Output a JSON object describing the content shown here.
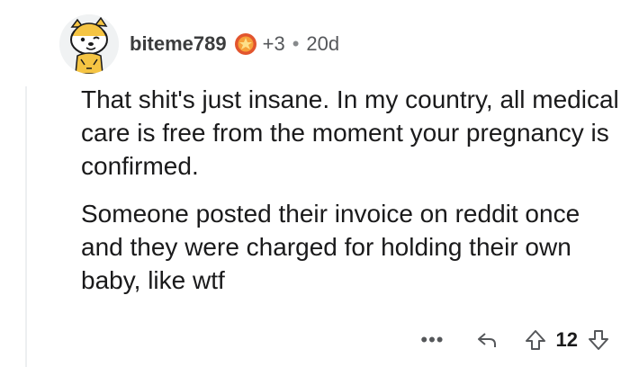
{
  "comment": {
    "username": "biteme789",
    "award_count": "+3",
    "separator": "•",
    "age": "20d",
    "paragraphs": [
      "That shit's just insane. In my country, all medical care is free from the moment your pregnancy is confirmed.",
      "Someone posted their invoice on reddit once and they were charged for holding their own baby, like wtf"
    ],
    "score": "12",
    "more_label": "•••"
  },
  "icons": {
    "avatar": "tiger-avatar",
    "award": "award-icon",
    "reply": "reply-icon",
    "upvote": "upvote-icon",
    "downvote": "downvote-icon"
  },
  "colors": {
    "award_red": "#e2552e",
    "avatar_yellow": "#f5c443",
    "thread_line": "#edeff1"
  }
}
